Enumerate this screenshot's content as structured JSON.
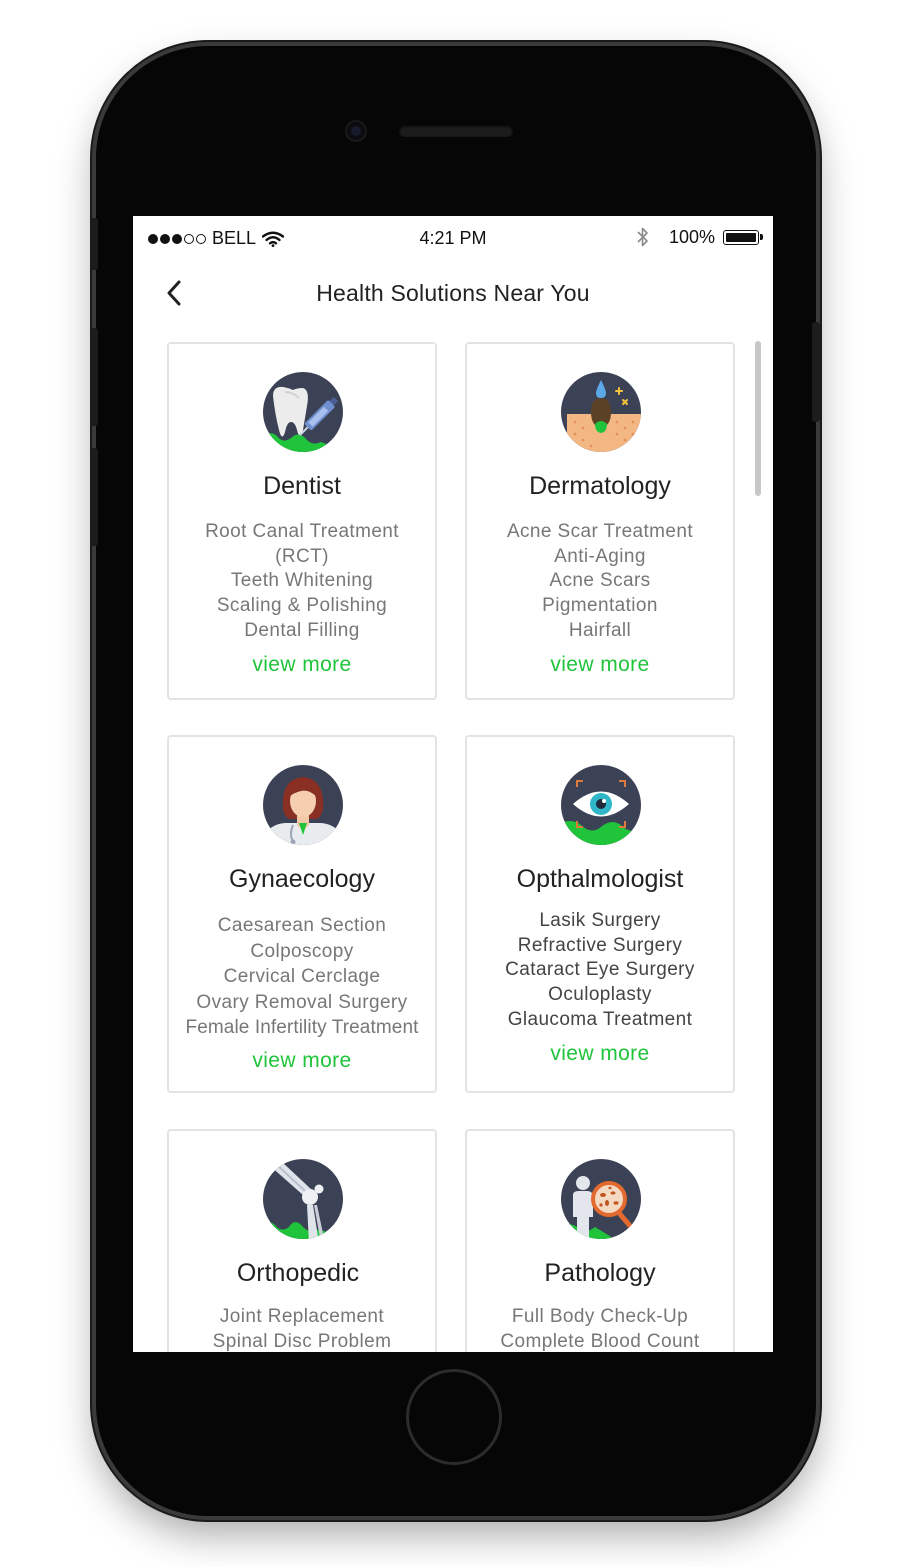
{
  "status_bar": {
    "carrier": "BELL",
    "time": "4:21 PM",
    "battery_percent": "100%",
    "signal_bars_filled": 3,
    "signal_bars_total": 5
  },
  "header": {
    "title": "Health Solutions Near You",
    "back_icon": "chevron-left-icon"
  },
  "accent_color": "#1fc43a",
  "cards": [
    {
      "title": "Dentist",
      "icon": "tooth-icon",
      "items": [
        "Root Canal Treatment",
        "(RCT)",
        "Teeth Whitening",
        "Scaling & Polishing",
        "Dental Filling"
      ],
      "link": "view more"
    },
    {
      "title": "Dermatology",
      "icon": "skin-icon",
      "items": [
        "Acne Scar Treatment",
        "Anti-Aging",
        "Acne Scars",
        "Pigmentation",
        "Hairfall"
      ],
      "link": "view more"
    },
    {
      "title": "Gynaecology",
      "icon": "female-doctor-icon",
      "items": [
        "Caesarean Section",
        "Colposcopy",
        "Cervical Cerclage",
        "Ovary Removal Surgery",
        "Female Infertility Treatment"
      ],
      "link": "view more"
    },
    {
      "title": "Opthalmologist",
      "icon": "eye-icon",
      "items": [
        "Lasik Surgery",
        "Refractive Surgery",
        "Cataract Eye Surgery",
        "Oculoplasty",
        "Glaucoma Treatment"
      ],
      "link": "view more"
    },
    {
      "title": "Orthopedic",
      "icon": "knee-joint-icon",
      "items": [
        "Joint Replacement",
        "Spinal Disc Problem"
      ],
      "link": ""
    },
    {
      "title": "Pathology",
      "icon": "microscope-magnifier-icon",
      "items": [
        "Full Body Check-Up",
        "Complete Blood Count"
      ],
      "link": ""
    }
  ]
}
